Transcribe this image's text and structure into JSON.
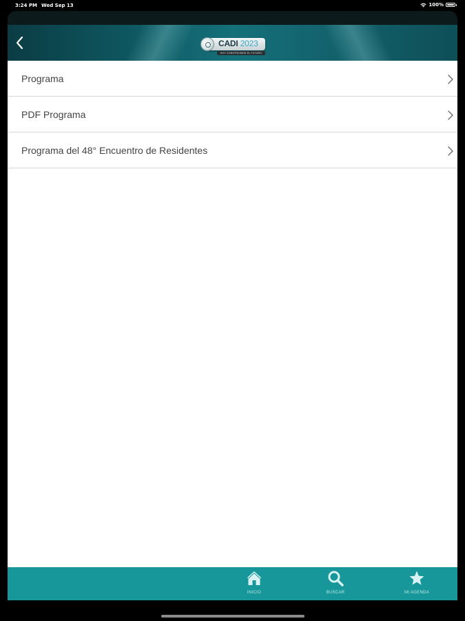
{
  "status_bar": {
    "time": "3:24 PM",
    "date": "Wed Sep 13",
    "battery": "100%",
    "wifi_icon": "wifi-icon",
    "battery_icon": "battery-icon"
  },
  "header": {
    "back_icon": "chevron-left-icon",
    "logo": {
      "name": "CADI",
      "year": "2023",
      "tagline": "HOY CONSTRUIMOS EL FUTURO"
    }
  },
  "list": {
    "items": [
      {
        "label": "Programa",
        "icon": "chevron-right-icon"
      },
      {
        "label": "PDF Programa",
        "icon": "chevron-right-icon"
      },
      {
        "label": "Programa del 48° Encuentro de Residentes",
        "icon": "chevron-right-icon"
      }
    ]
  },
  "tab_bar": {
    "tabs": [
      {
        "label": "INICIO",
        "icon": "home-icon"
      },
      {
        "label": "BUSCAR",
        "icon": "search-icon"
      },
      {
        "label": "MI AGENDA",
        "icon": "star-icon"
      }
    ]
  },
  "colors": {
    "header_bg": "#0f5a63",
    "tab_bar_bg": "#17979a",
    "tab_icon": "#d9f3f4",
    "list_text": "#444444",
    "divider": "#d6d6d6"
  }
}
